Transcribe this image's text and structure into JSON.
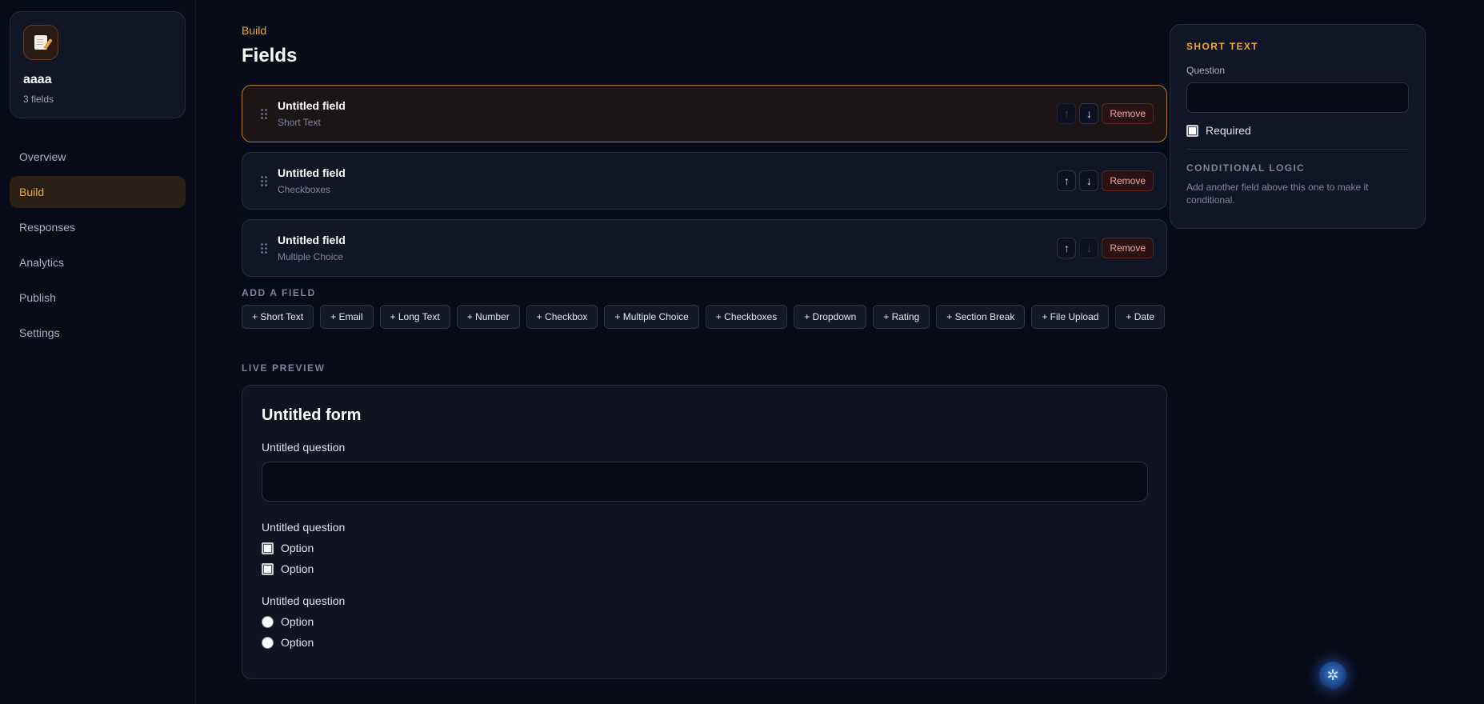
{
  "form": {
    "name": "aaaa",
    "field_count": "3 fields",
    "icon": "memo-icon"
  },
  "nav": [
    {
      "id": "overview",
      "label": "Overview",
      "active": false
    },
    {
      "id": "build",
      "label": "Build",
      "active": true
    },
    {
      "id": "responses",
      "label": "Responses",
      "active": false
    },
    {
      "id": "analytics",
      "label": "Analytics",
      "active": false
    },
    {
      "id": "publish",
      "label": "Publish",
      "active": false
    },
    {
      "id": "settings",
      "label": "Settings",
      "active": false
    }
  ],
  "header": {
    "breadcrumb": "Build",
    "title": "Fields"
  },
  "fields": [
    {
      "title": "Untitled field",
      "type": "Short Text",
      "selected": true,
      "up": "↑",
      "down": "↓",
      "remove": "Remove"
    },
    {
      "title": "Untitled field",
      "type": "Checkboxes",
      "selected": false,
      "up": "↑",
      "down": "↓",
      "remove": "Remove"
    },
    {
      "title": "Untitled field",
      "type": "Multiple Choice",
      "selected": false,
      "up": "↑",
      "down": "↓",
      "remove": "Remove"
    }
  ],
  "add_field": {
    "label": "ADD A FIELD",
    "buttons": [
      "+ Short Text",
      "+ Email",
      "+ Long Text",
      "+ Number",
      "+ Checkbox",
      "+ Multiple Choice",
      "+ Checkboxes",
      "+ Dropdown",
      "+ Rating",
      "+ Section Break",
      "+ File Upload",
      "+ Date"
    ]
  },
  "preview": {
    "label": "LIVE PREVIEW",
    "form_title": "Untitled form",
    "questions": [
      {
        "label": "Untitled question"
      },
      {
        "label": "Untitled question",
        "options": [
          "Option",
          "Option"
        ]
      },
      {
        "label": "Untitled question",
        "options": [
          "Option",
          "Option"
        ]
      }
    ]
  },
  "properties": {
    "type_label": "SHORT TEXT",
    "question_label": "Question",
    "required_label": "Required",
    "conditional_label": "CONDITIONAL LOGIC",
    "conditional_text": "Add another field above this one to make it conditional."
  },
  "colors": {
    "accent": "#f0a92b",
    "background": "#070a17",
    "danger": "#f2a7a0"
  }
}
